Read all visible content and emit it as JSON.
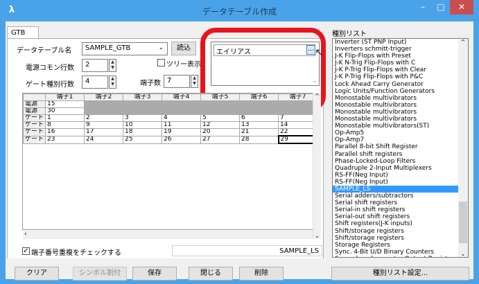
{
  "window": {
    "title": "データテーブル作成",
    "min": "–",
    "max": "□",
    "close": "✕",
    "app_icon": "λ"
  },
  "tab": "GTB",
  "form": {
    "table_name_label": "データテーブル名",
    "table_name_value": "SAMPLE_GTB",
    "read_button": "読込",
    "tree_view_label": "ツリー表示",
    "power_rows_label": "電源コモン行数",
    "power_rows_value": "2",
    "gate_kinds_label": "ゲート種別行数",
    "gate_kinds_value": "4",
    "pin_count_label": "端子数",
    "pin_count_value": "7"
  },
  "alias": {
    "value": "エイリアス",
    "button": "…"
  },
  "grid": {
    "columns": [
      "端子1",
      "端子2",
      "端子3",
      "端子4",
      "端子5",
      "端子6",
      "端子7"
    ],
    "rows": [
      {
        "type": "電源",
        "values": [
          "15"
        ]
      },
      {
        "type": "電源",
        "values": [
          "30"
        ]
      },
      {
        "type": "ゲート",
        "values": [
          "1",
          "2",
          "3",
          "4",
          "5",
          "6",
          "7"
        ]
      },
      {
        "type": "ゲート",
        "values": [
          "8",
          "9",
          "10",
          "11",
          "12",
          "13",
          "14"
        ]
      },
      {
        "type": "ゲート",
        "values": [
          "16",
          "17",
          "18",
          "19",
          "20",
          "21",
          "22"
        ]
      },
      {
        "type": "ゲート",
        "values": [
          "23",
          "24",
          "25",
          "26",
          "27",
          "28",
          "29"
        ]
      }
    ]
  },
  "check_duplicate_label": "端子番号重複をチェックする",
  "status_text": "SAMPLE_LS",
  "kind_list": {
    "title": "種別リスト",
    "selected": "SAMPLE_LS",
    "items": [
      "Inverter (ST PNP Input)",
      "Inverters schmitt-trigger",
      "J-K Flip-Flops with Preset",
      "J-K N-Trig Flip-Flops with C",
      "J-K P-Trig Flip-Flops with Clear",
      "J-K P-Trig Flip-Flops with P&C",
      "Lock Ahead Carry Generator",
      "Logic Units/Function Generators",
      "Monostable multivibrators",
      "Monostable multivibrators",
      "Monostable multivibrators",
      "Monostable multivibrators",
      "Monostable multivibrators(ST)",
      "Op-Amp5",
      "Op-Amp7",
      "Parallel 8-bit Shift Register",
      "Parallel shift registers",
      "Phase-Locked-Loop Filters",
      "Quadruple 2-Input Multiplexers",
      "RS-FF(Neg Input)",
      "RS-FF(Neg Input)",
      "SAMPLE_LS",
      "Serial adders/subtractors",
      "Serial shift registers",
      "Serial-in shift registers",
      "Serial-out shift registers",
      "Shift registers(J-K inputs)",
      "Shift/storage registers",
      "Shift/storage registers",
      "Storage Registers",
      "Sync. 4-Bit U/D Binary Counters",
      "Sync. decade counter Output Registers"
    ]
  },
  "buttons": {
    "clear": "クリア",
    "symbol_assign": "シンボル割付",
    "save": "保存",
    "close": "閉じる",
    "delete": "削除",
    "kind_settings": "種別リスト設定..."
  },
  "colors": {
    "titlebar": "#4aa3e8",
    "highlight": "#e8141c",
    "selection": "#3399ff"
  }
}
